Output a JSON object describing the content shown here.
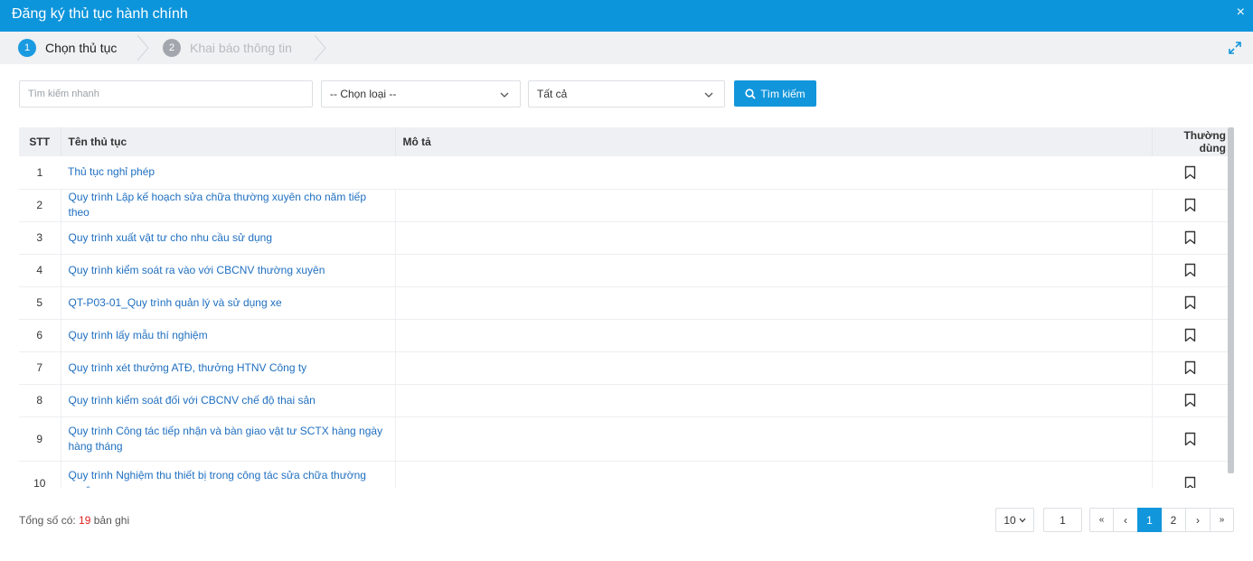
{
  "window": {
    "title": "Đăng ký thủ tục hành chính",
    "close_label": "×"
  },
  "steps": [
    {
      "num": "1",
      "label": "Chọn thủ tục"
    },
    {
      "num": "2",
      "label": "Khai báo thông tin"
    }
  ],
  "filters": {
    "search_placeholder": "Tìm kiếm nhanh",
    "type_select_value": "-- Chọn loại --",
    "scope_select_value": "Tất cả",
    "search_button_label": "Tìm kiếm"
  },
  "table": {
    "columns": {
      "stt": "STT",
      "name": "Tên thủ tục",
      "desc": "Mô tả",
      "fav": "Thường dùng"
    },
    "rows": [
      {
        "stt": "1",
        "name": "Thủ tục nghỉ phép",
        "desc": ""
      },
      {
        "stt": "2",
        "name": "Quy trình Lập kế hoạch sửa chữa thường xuyên cho năm tiếp theo",
        "desc": ""
      },
      {
        "stt": "3",
        "name": "Quy trình xuất vật tư cho nhu cầu sử dụng",
        "desc": ""
      },
      {
        "stt": "4",
        "name": "Quy trình kiểm soát ra vào với CBCNV thường xuyên",
        "desc": ""
      },
      {
        "stt": "5",
        "name": "QT-P03-01_Quy trình quản lý và sử dụng xe",
        "desc": ""
      },
      {
        "stt": "6",
        "name": "Quy trình lấy mẫu thí nghiệm",
        "desc": ""
      },
      {
        "stt": "7",
        "name": "Quy trình xét thưởng ATĐ, thưởng HTNV Công ty",
        "desc": ""
      },
      {
        "stt": "8",
        "name": "Quy trình kiểm soát đối với CBCNV chế độ thai sản",
        "desc": ""
      },
      {
        "stt": "9",
        "name": "Quy trình Công tác tiếp nhận và bàn giao vật tư SCTX hàng ngày hàng tháng",
        "desc": ""
      },
      {
        "stt": "10",
        "name": "Quy trình Nghiệm thu thiết bị trong công tác sửa chữa thường xuyên",
        "desc": ""
      }
    ]
  },
  "footer": {
    "total_prefix": "Tổng số có: ",
    "total_count": "19",
    "total_suffix": " bản ghi"
  },
  "pagination": {
    "page_size": "10",
    "current_page_input": "1",
    "first": "«",
    "prev": "‹",
    "pages": [
      "1",
      "2"
    ],
    "active_page": "1",
    "next": "›",
    "last": "»"
  },
  "colors": {
    "header_bg": "#0d95db",
    "primary": "#1296db",
    "link": "#1f6fc0",
    "count": "#e02020"
  }
}
